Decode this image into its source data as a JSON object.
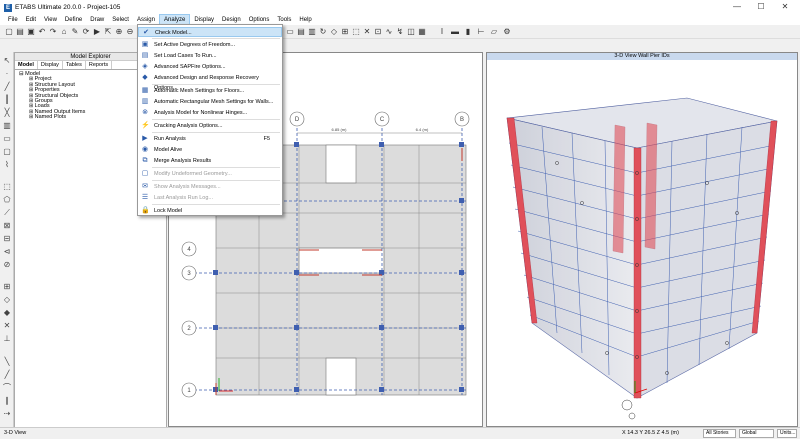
{
  "window": {
    "title": "ETABS Ultimate 20.0.0 - Project-105",
    "minimize": "—",
    "maximize": "☐",
    "close": "✕",
    "app_icon": "E"
  },
  "menubar": [
    "File",
    "Edit",
    "View",
    "Define",
    "Draw",
    "Select",
    "Assign",
    "Analyze",
    "Display",
    "Design",
    "Options",
    "Tools",
    "Help"
  ],
  "active_menu": "Analyze",
  "analyze_menu": [
    {
      "label": "Check Model...",
      "icon": "check-icon",
      "glyph": "✔",
      "shortcut": "",
      "disabled": false,
      "highlight": true,
      "sep_after": true
    },
    {
      "label": "Set Active Degrees of Freedom...",
      "icon": "dof-icon",
      "glyph": "▣",
      "shortcut": "",
      "disabled": false,
      "highlight": false,
      "sep_after": false
    },
    {
      "label": "Set Load Cases To Run...",
      "icon": "loadcases-icon",
      "glyph": "▤",
      "shortcut": "",
      "disabled": false,
      "highlight": false,
      "sep_after": false
    },
    {
      "label": "Advanced SAPFire Options...",
      "icon": "sapfire-icon",
      "glyph": "◈",
      "shortcut": "",
      "disabled": false,
      "highlight": false,
      "sep_after": false
    },
    {
      "label": "Advanced Design and Response Recovery Options...",
      "icon": "recovery-icon",
      "glyph": "◆",
      "shortcut": "",
      "disabled": false,
      "highlight": false,
      "sep_after": true
    },
    {
      "label": "Automatic Mesh Settings for Floors...",
      "icon": "mesh-floor-icon",
      "glyph": "▦",
      "shortcut": "",
      "disabled": false,
      "highlight": false,
      "sep_after": false
    },
    {
      "label": "Automatic Rectangular Mesh Settings for Walls...",
      "icon": "mesh-wall-icon",
      "glyph": "▥",
      "shortcut": "",
      "disabled": false,
      "highlight": false,
      "sep_after": false
    },
    {
      "label": "Analysis Model for Nonlinear Hinges...",
      "icon": "hinge-icon",
      "glyph": "⊗",
      "shortcut": "",
      "disabled": false,
      "highlight": false,
      "sep_after": true
    },
    {
      "label": "Cracking Analysis Options...",
      "icon": "cracking-icon",
      "glyph": "⚡",
      "shortcut": "",
      "disabled": false,
      "highlight": false,
      "sep_after": true
    },
    {
      "label": "Run Analysis",
      "icon": "run-icon",
      "glyph": "▶",
      "shortcut": "F5",
      "disabled": false,
      "highlight": false,
      "sep_after": false
    },
    {
      "label": "Model Alive",
      "icon": "model-alive-icon",
      "glyph": "◉",
      "shortcut": "",
      "disabled": false,
      "highlight": false,
      "sep_after": false
    },
    {
      "label": "Merge Analysis Results",
      "icon": "merge-icon",
      "glyph": "⧉",
      "shortcut": "",
      "disabled": false,
      "highlight": false,
      "sep_after": true
    },
    {
      "label": "Modify Undeformed Geometry...",
      "icon": "geometry-icon",
      "glyph": "▢",
      "shortcut": "",
      "disabled": true,
      "highlight": false,
      "sep_after": true
    },
    {
      "label": "Show Analysis Messages...",
      "icon": "messages-icon",
      "glyph": "✉",
      "shortcut": "",
      "disabled": true,
      "highlight": false,
      "sep_after": false
    },
    {
      "label": "Last Analysis Run Log...",
      "icon": "log-icon",
      "glyph": "☰",
      "shortcut": "",
      "disabled": true,
      "highlight": false,
      "sep_after": true
    },
    {
      "label": "Lock Model",
      "icon": "lock-icon",
      "glyph": "🔒",
      "shortcut": "",
      "disabled": false,
      "highlight": false,
      "sep_after": false
    }
  ],
  "explorer": {
    "title": "Model Explorer",
    "tabs": [
      "Model",
      "Display",
      "Tables",
      "Reports"
    ],
    "root": "Model",
    "children": [
      "Project",
      "Structure Layout",
      "Properties",
      "Structural Objects",
      "Groups",
      "Loads",
      "Named Output Items",
      "Named Plots"
    ]
  },
  "view2": {
    "title": "3-D View  Wall Pier IDs"
  },
  "plan": {
    "grid_cols": [
      "D",
      "C",
      "B"
    ],
    "grid_rows": [
      "4",
      "3",
      "2",
      "1"
    ],
    "dims": [
      "6.85 (m)",
      "6.4 (m)"
    ]
  },
  "status": {
    "left": "3-D View",
    "coords": "X 14.3  Y 26.5  Z 4.5 (m)",
    "stories": "All Stories",
    "system": "Global",
    "units": "Units..."
  },
  "colors": {
    "accent": "#cce4f7",
    "pier": "#e0505a",
    "beam": "#3f5fb0"
  }
}
